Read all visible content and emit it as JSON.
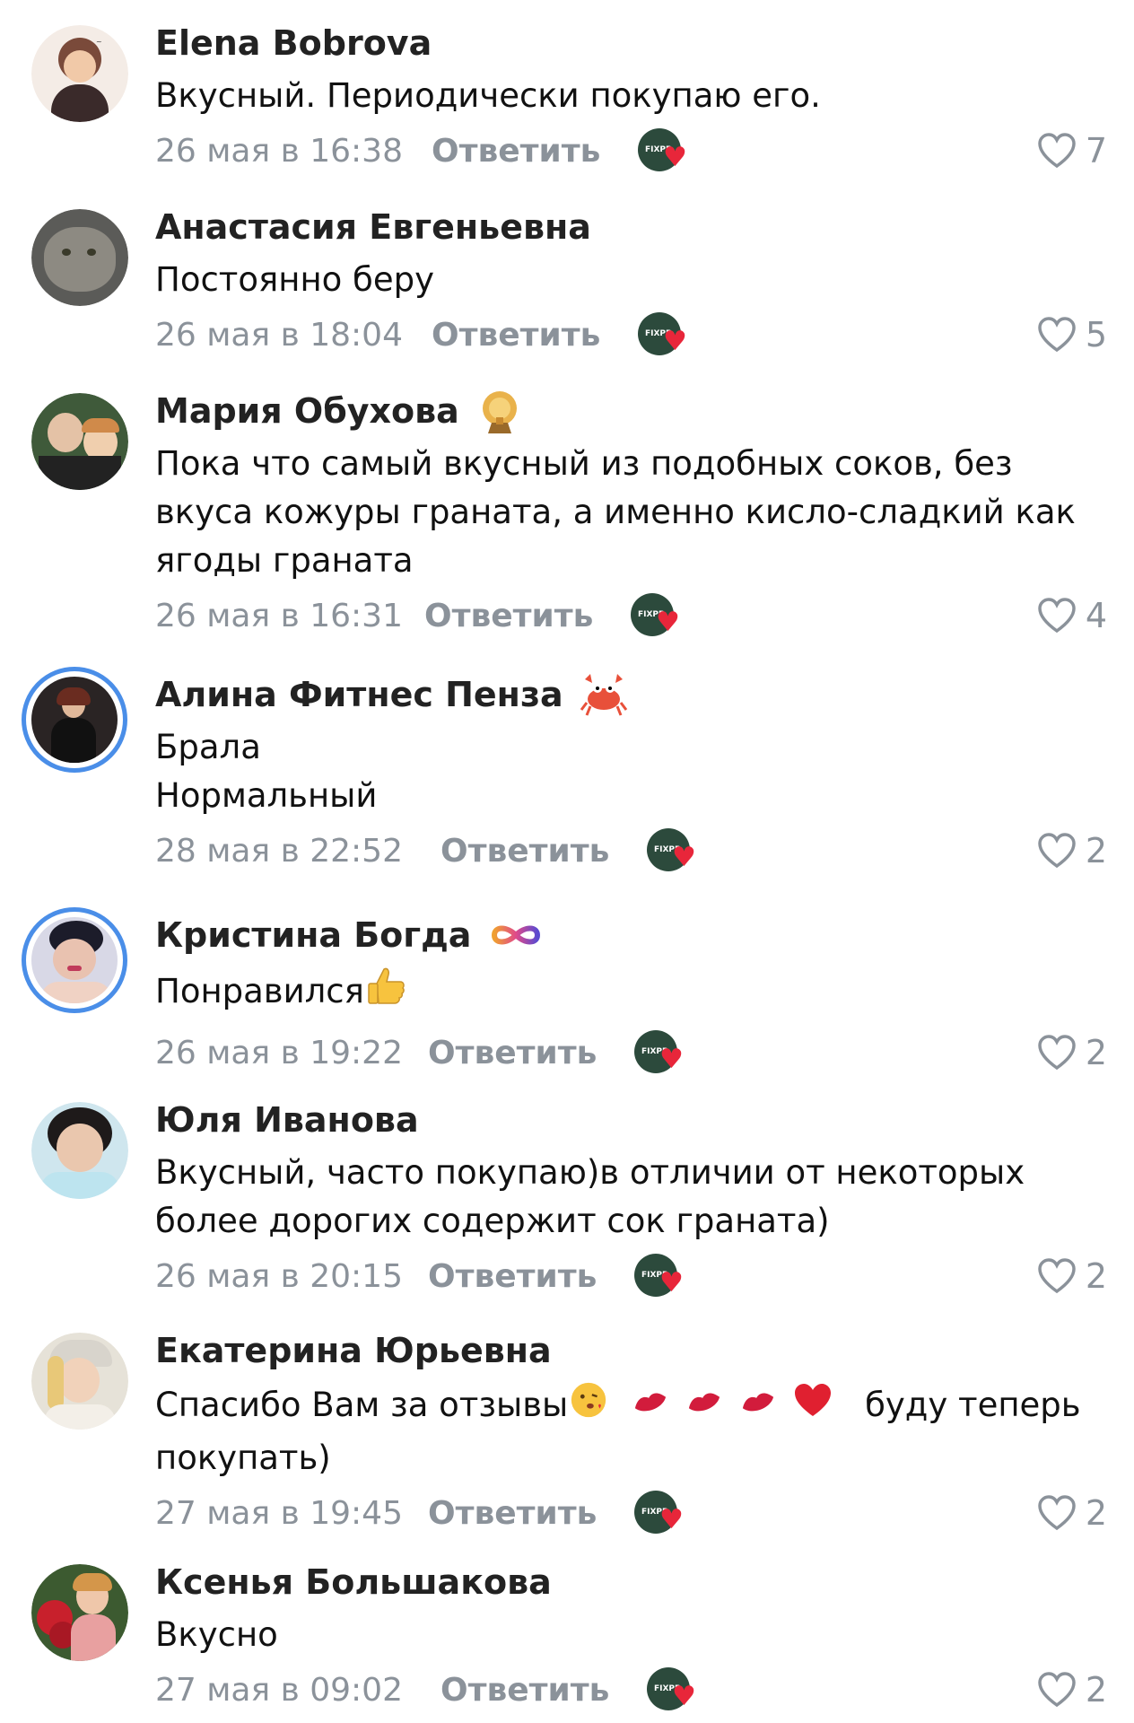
{
  "colors": {
    "meta": "#8b929a",
    "story_ring": "#4a8ee8",
    "reaction_heart": "#e8263a"
  },
  "comments": [
    {
      "author": "Elena Bobrova",
      "text_lines": [
        "Вкусный. Периодически покупаю его."
      ],
      "date": "26 мая в 16:38",
      "reply": "Ответить",
      "likes": "7"
    },
    {
      "author": "Анастасия Евгеньевна",
      "text_lines": [
        "Постоянно беру"
      ],
      "date": "26 мая в 18:04",
      "reply": "Ответить",
      "likes": "5"
    },
    {
      "author": "Мария Обухова",
      "badge_icon": "trophy-badge-icon",
      "text_lines": [
        "Пока что самый вкусный из подобных соков, без",
        "вкуса кожуры граната, а именно кисло-сладкий как",
        "ягоды граната"
      ],
      "date": "26 мая в 16:31",
      "reply": "Ответить",
      "likes": "4"
    },
    {
      "author": "Алина Фитнес Пенза",
      "badge_icon": "crab-emoji-icon",
      "text_lines": [
        "Брала",
        "Нормальный"
      ],
      "date": "28 мая в 22:52",
      "reply": "Ответить",
      "likes": "2"
    },
    {
      "author": "Кристина Богда",
      "badge_icon": "infinity-icon",
      "text_lines": [
        "Понравился"
      ],
      "date": "26 мая в 19:22",
      "reply": "Ответить",
      "likes": "2"
    },
    {
      "author": "Юля Иванова",
      "text_lines": [
        "Вкусный, часто покупаю)в отличии от некоторых",
        "более дорогих содержит сок граната)"
      ],
      "date": "26 мая в 20:15",
      "reply": "Ответить",
      "likes": "2"
    },
    {
      "author": "Екатерина Юрьевна",
      "text_lines": [
        "Спасибо Вам за отзывы",
        "буду теперь",
        "покупать)"
      ],
      "date": "27 мая в 19:45",
      "reply": "Ответить",
      "likes": "2"
    },
    {
      "author": "Ксенья Большакова",
      "text_lines": [
        "Вкусно"
      ],
      "date": "27 мая в 09:02",
      "reply": "Ответить",
      "likes": "2"
    }
  ],
  "reaction_badge_text": "FIXPR"
}
